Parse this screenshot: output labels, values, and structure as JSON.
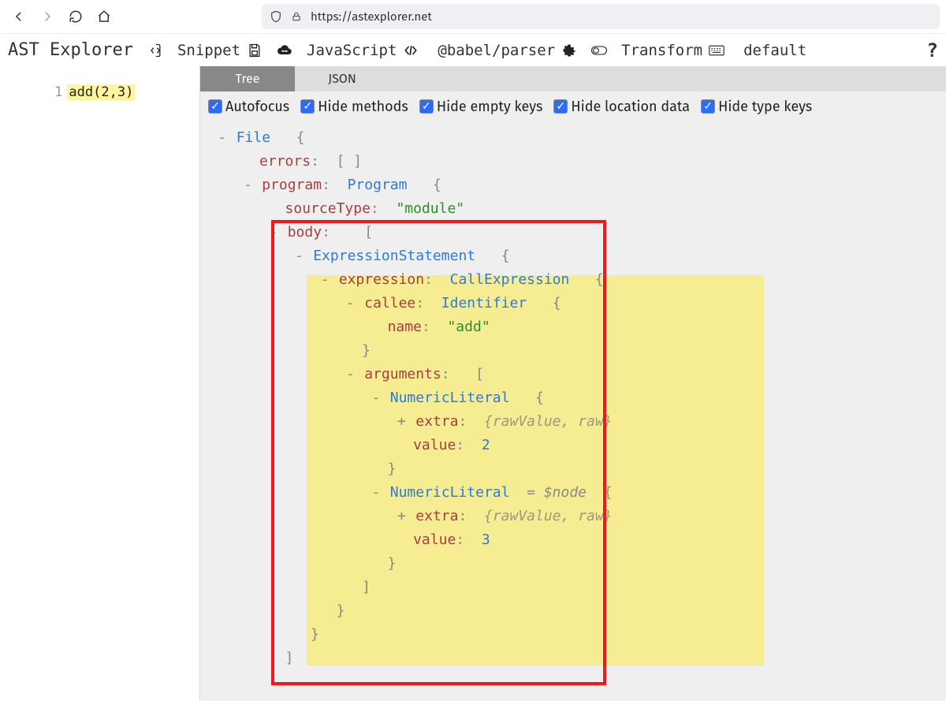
{
  "browser": {
    "url": "https://astexplorer.net"
  },
  "toolbar": {
    "title": "AST Explorer",
    "snippet": "Snippet",
    "language": "JavaScript",
    "parser": "@babel/parser",
    "transform": "Transform",
    "transform_mode": "default"
  },
  "tabs": {
    "tree": "Tree",
    "json": "JSON"
  },
  "options": {
    "autofocus": "Autofocus",
    "hide_methods": "Hide methods",
    "hide_empty_keys": "Hide empty keys",
    "hide_location_data": "Hide location data",
    "hide_type_keys": "Hide type keys"
  },
  "editor": {
    "line_no": "1",
    "code": "add(2,3)"
  },
  "ast": {
    "file_type": "File",
    "errors_key": "errors",
    "empty_array": "[ ]",
    "program_key": "program",
    "program_type": "Program",
    "sourceType_key": "sourceType",
    "sourceType_val": "\"module\"",
    "body_key": "body",
    "expr_stmt": "ExpressionStatement",
    "expression_key": "expression",
    "call_expr": "CallExpression",
    "callee_key": "callee",
    "identifier": "Identifier",
    "name_key": "name",
    "name_val": "\"add\"",
    "arguments_key": "arguments",
    "num_lit": "NumericLiteral",
    "extra_key": "extra",
    "extra_hint": "{rawValue, raw}",
    "value_key": "value",
    "val_2": "2",
    "val_3": "3",
    "node_eq": "= $node"
  },
  "glyphs": {
    "open_brace": "{",
    "close_brace": "}",
    "open_bracket": "[",
    "close_bracket": "]",
    "minus": "-",
    "plus": "+",
    "colon": ":"
  }
}
